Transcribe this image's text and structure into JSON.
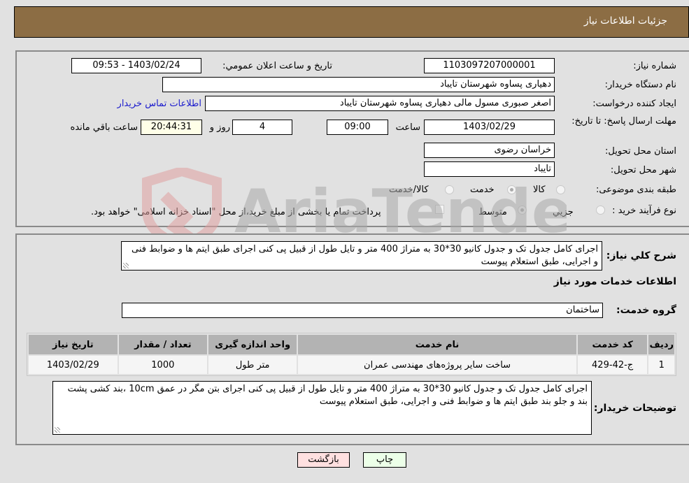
{
  "header": {
    "title": "جزئیات اطلاعات نیاز"
  },
  "form": {
    "need_number": {
      "label": "شماره نیاز:",
      "value": "1103097207000001"
    },
    "announce_datetime": {
      "label": "تاریخ و ساعت اعلان عمومي:",
      "value": "1403/02/24 - 09:53"
    },
    "buyer_org": {
      "label": "نام دستگاه خريدار:",
      "value": "دهیاری پساوه  شهرستان تایباد"
    },
    "requester": {
      "label": "ایجاد کننده درخواست:",
      "value": "اصغر صبوری مسول مالی دهیاری پساوه  شهرستان تایباد",
      "contact_link": "اطلاعات تماس خريدار"
    },
    "deadline": {
      "label": "مهلت ارسال پاسخ: تا تاریخ:",
      "date": "1403/02/29",
      "time_label": "ساعت",
      "time": "09:00",
      "days": "4",
      "days_label": "روز و",
      "remaining": "20:44:31",
      "remaining_label": "ساعت باقي مانده"
    },
    "province": {
      "label": "استان محل تحويل:",
      "value": "خراسان رضوی"
    },
    "city": {
      "label": "شهر محل تحويل:",
      "value": "تایباد"
    },
    "category": {
      "label": "طبقه بندی موضوعی:",
      "options": [
        "کالا",
        "خدمت",
        "کالا/خدمت"
      ],
      "selected": "خدمت"
    },
    "purchase_type": {
      "label": "نوع فرآیند خرید :",
      "options": [
        "جزيي",
        "متوسط"
      ],
      "selected": "متوسط",
      "treasury_note": "پرداخت تمام یا بخشی از مبلغ خرید،از محل \"اسناد خزانه اسلامی\" خواهد بود."
    }
  },
  "summary": {
    "label": "شرح کلي نياز:",
    "value": "اجرای کامل جدول تک و جدول کانیو 30*30 به متراژ 400 متر و تایل طول از قبیل پی کنی اجرای  طبق ایتم ها و ضوابط فنی و اجرایی، طبق استعلام پیوست"
  },
  "services_section": {
    "title": "اطلاعات خدمات مورد نياز",
    "group_label": "گروه خدمت:",
    "group_value": "ساختمان",
    "table": {
      "headers": [
        "رديف",
        "کد خدمت",
        "نام خدمت",
        "واحد اندازه گيری",
        "تعداد / مقدار",
        "تاريخ نياز"
      ],
      "rows": [
        [
          "1",
          "ج-42-429",
          "ساخت سایر پروژه‌های مهندسی عمران",
          "متر طول",
          "1000",
          "1403/02/29"
        ]
      ]
    }
  },
  "buyer_notes": {
    "label": "توضيحات خريدار:",
    "value": "اجرای کامل جدول تک و جدول کانیو 30*30 به متراژ 400 متر و تایل طول از قبیل پی کنی اجرای بتن مگر در عمق 10cm ،بند کشی پشت بند و جلو بند  طبق ایتم ها و ضوابط فنی و اجرایی، طبق استعلام پیوست"
  },
  "buttons": {
    "print": "چاپ",
    "back": "بازگشت"
  },
  "colors": {
    "header": "#8c6d44",
    "print_bg": "#ecffe8",
    "back_bg": "#ffe0e0",
    "link": "#1a1acd"
  },
  "watermark": {
    "text": "AriaTender.neT"
  }
}
